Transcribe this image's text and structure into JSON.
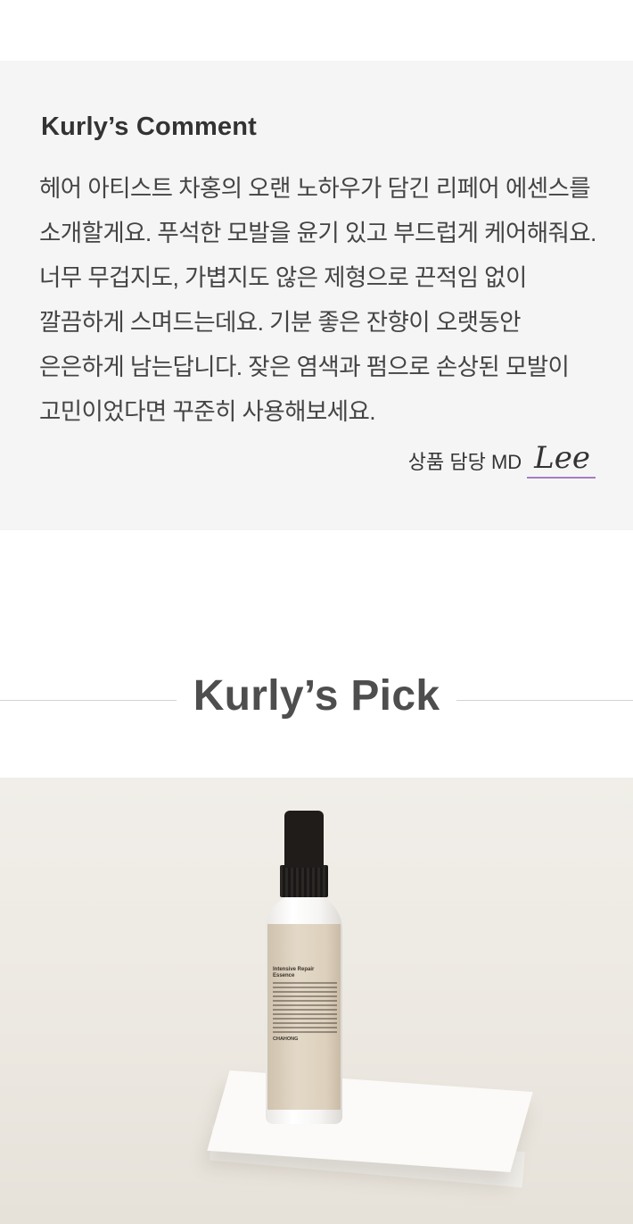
{
  "comment": {
    "title": "Kurly’s Comment",
    "body": "헤어 아티스트 차홍의 오랜 노하우가 담긴 리페어 에센스를 소개할게요. 푸석한 모발을 윤기 있고 부드럽게 케어해줘요. 너무 무겁지도, 가볍지도 않은 제형으로 끈적임 없이 깔끔하게 스며드는데요. 기분 좋은 잔향이 오랫동안 은은하게 남는답니다. 잦은 염색과 펌으로 손상된 모발이 고민이었다면 꾸준히 사용해보세요.",
    "md_label": "상품 담당 MD",
    "md_signature": "Lee"
  },
  "pick": {
    "title": "Kurly’s Pick"
  },
  "product": {
    "label_title": "Intensive Repair Essence",
    "brand": "CHAHONG"
  },
  "colors": {
    "comment_bg": "#f5f5f5",
    "signature_underline": "#a67dc2",
    "pick_title": "#4e4e4e"
  }
}
